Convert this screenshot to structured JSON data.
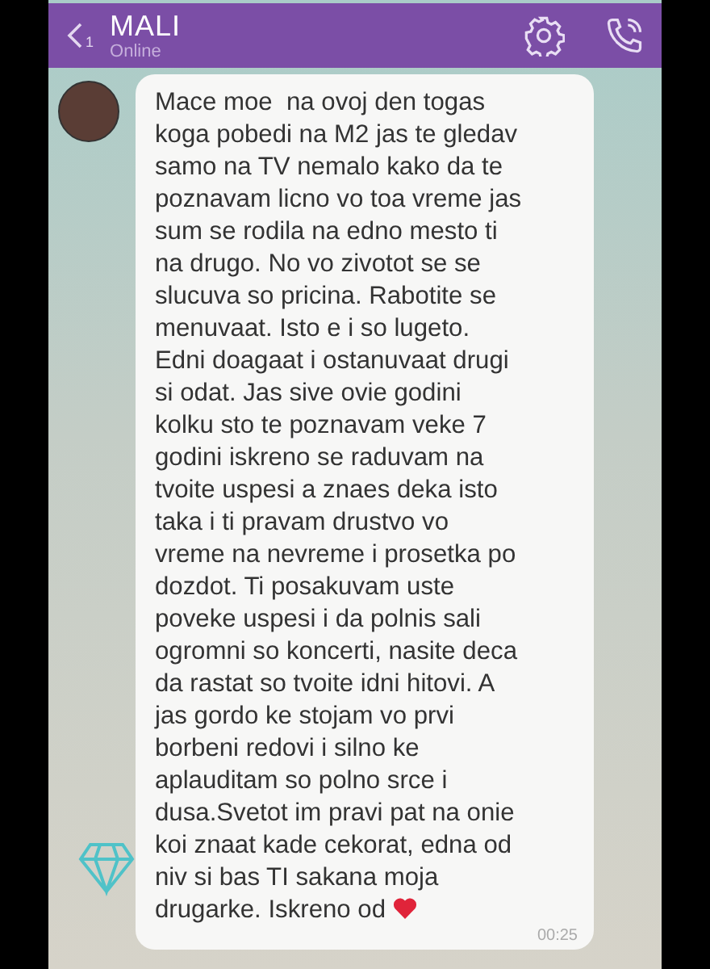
{
  "header": {
    "back_count": "1",
    "title": "MALI",
    "status": "Online"
  },
  "messages": [
    {
      "text": "Mace moe  na ovoj den togas\nkoga pobedi na M2 jas te gledav\nsamo na TV nemalo kako da te\npoznavam licno vo toa vreme jas\nsum se rodila na edno mesto ti\nna drugo. No vo zivotot se se\nslucuva so pricina. Rabotite se\nmenuvaat. Isto e i so lugeto.\nEdni doagaat i ostanuvaat drugi\nsi odat. Jas sive ovie godini\nkolku sto te poznavam veke 7\ngodini iskreno se raduvam na\ntvoite uspesi a znaes deka isto\ntaka i ti pravam drustvo vo\nvreme na nevreme i prosetka po\ndozdot. Ti posakuvam uste\npoveke uspesi i da polnis sali\nogromni so koncerti, nasite deca\nda rastat so tvoite idni hitovi. A\njas gordo ke stojam vo prvi\nborbeni redovi i silno ke\naplauditam so polno srce i\ndusa.Svetot im pravi pat na onie\nkoi znaat kade cekorat, edna od\nniv si bas TI sakana moja\ndrugarke. Iskreno od",
      "time": "00:25"
    }
  ]
}
